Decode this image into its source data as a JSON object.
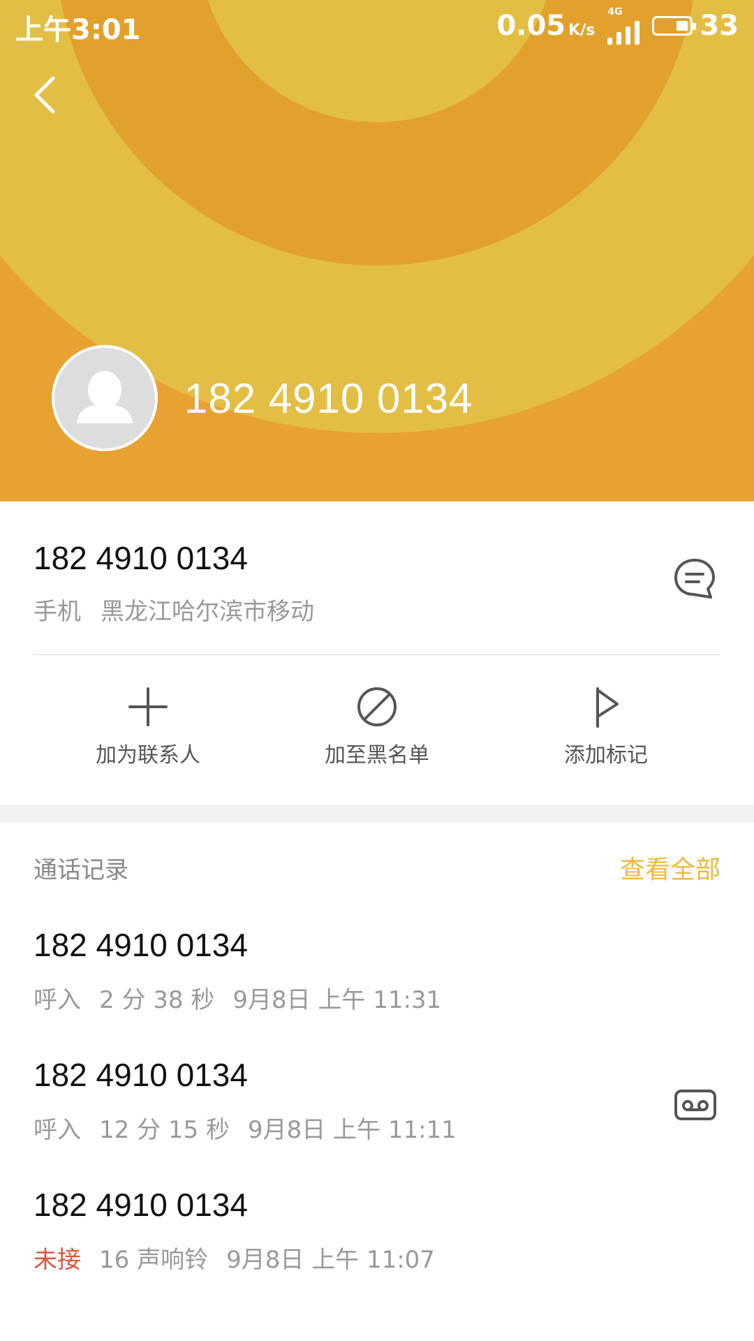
{
  "status_bar": {
    "time": "上午3:01",
    "net_speed": "0.05",
    "net_unit": "K/s",
    "network_type": "4G",
    "battery_level": "33"
  },
  "header": {
    "phone_number": "182 4910 0134",
    "icons": {
      "back": "chevron-left-icon",
      "avatar": "person-icon"
    },
    "colors": {
      "outer": "#E7A232",
      "ring_light": "#E3BE45",
      "ring_dark": "#E2A12D"
    }
  },
  "info": {
    "phone_number": "182 4910 0134",
    "type": "手机",
    "location": "黑龙江哈尔滨市移动"
  },
  "actions": [
    {
      "label": "加为联系人",
      "icon": "plus-icon"
    },
    {
      "label": "加至黑名单",
      "icon": "block-icon"
    },
    {
      "label": "添加标记",
      "icon": "flag-icon"
    }
  ],
  "call_log": {
    "title": "通话记录",
    "view_all": "查看全部",
    "accent_color": "#F1B73F",
    "entries": [
      {
        "number": "182 4910 0134",
        "status": "呼入",
        "detail": "2 分 38 秒",
        "datetime": "9月8日 上午 11:31",
        "missed": false,
        "voicemail": false
      },
      {
        "number": "182 4910 0134",
        "status": "呼入",
        "detail": "12 分 15 秒",
        "datetime": "9月8日 上午 11:11",
        "missed": false,
        "voicemail": true
      },
      {
        "number": "182 4910 0134",
        "status": "未接",
        "detail": "16 声响铃",
        "datetime": "9月8日 上午 11:07",
        "missed": true,
        "voicemail": false
      }
    ]
  }
}
